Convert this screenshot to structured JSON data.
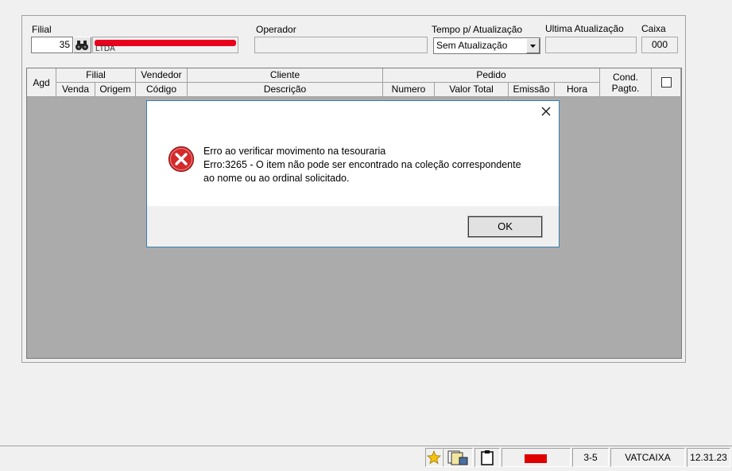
{
  "header": {
    "filial_label": "Filial",
    "filial_value": "35",
    "company_name_fragment": "LTDA",
    "operador_label": "Operador",
    "operador_value": "",
    "tempo_label": "Tempo p/ Atualização",
    "tempo_value": "Sem Atualização",
    "ultima_label": "Ultima Atualização",
    "ultima_value": "",
    "caixa_label": "Caixa",
    "caixa_value": "000"
  },
  "grid": {
    "agd": "Agd",
    "filial": "Filial",
    "venda": "Venda",
    "origem": "Origem",
    "vendedor": "Vendedor",
    "codigo": "Código",
    "cliente": "Cliente",
    "descricao": "Descrição",
    "pedido": "Pedido",
    "numero": "Numero",
    "valor_total": "Valor Total",
    "emissao": "Emissão",
    "hora": "Hora",
    "cond_pagto": "Cond. Pagto."
  },
  "dialog": {
    "line1": "Erro ao verificar movimento na tesouraria",
    "line2": "Erro:3265 - O item não pode ser encontrado na coleção correspondente",
    "line3": "ao nome ou ao ordinal solicitado.",
    "ok_label": "OK",
    "icon": "error-icon"
  },
  "statusbar": {
    "code": "3-5",
    "station": "VATCAIXA",
    "time": "12.31.23",
    "indicator_color": "#e00000"
  }
}
